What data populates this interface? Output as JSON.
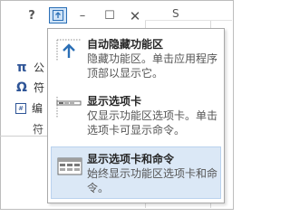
{
  "titlebar": {
    "help_label": "?",
    "minimize_label": "–",
    "maximize_label": "☐",
    "close_label": "✕",
    "column_header": "S"
  },
  "background": {
    "items": [
      {
        "symbol": "π",
        "label": "公"
      },
      {
        "symbol": "Ω",
        "label": "符"
      },
      {
        "symbol": "#",
        "label": "编"
      }
    ],
    "group_label": "符"
  },
  "menu": {
    "items": [
      {
        "title": "自动隐藏功能区",
        "description": "隐藏功能区。单击应用程序顶部以显示它。",
        "icon": "auto-hide-ribbon-icon",
        "selected": false
      },
      {
        "title": "显示选项卡",
        "description": "仅显示功能区选项卡。单击选项卡可显示命令。",
        "icon": "show-tabs-icon",
        "selected": false
      },
      {
        "title": "显示选项卡和命令",
        "description": "始终显示功能区选项卡和命令。",
        "icon": "show-tabs-and-commands-icon",
        "selected": true
      }
    ]
  },
  "colors": {
    "accent": "#2b6fb6",
    "selected_bg": "#dbe8f6",
    "selected_border": "#bad2ee"
  }
}
